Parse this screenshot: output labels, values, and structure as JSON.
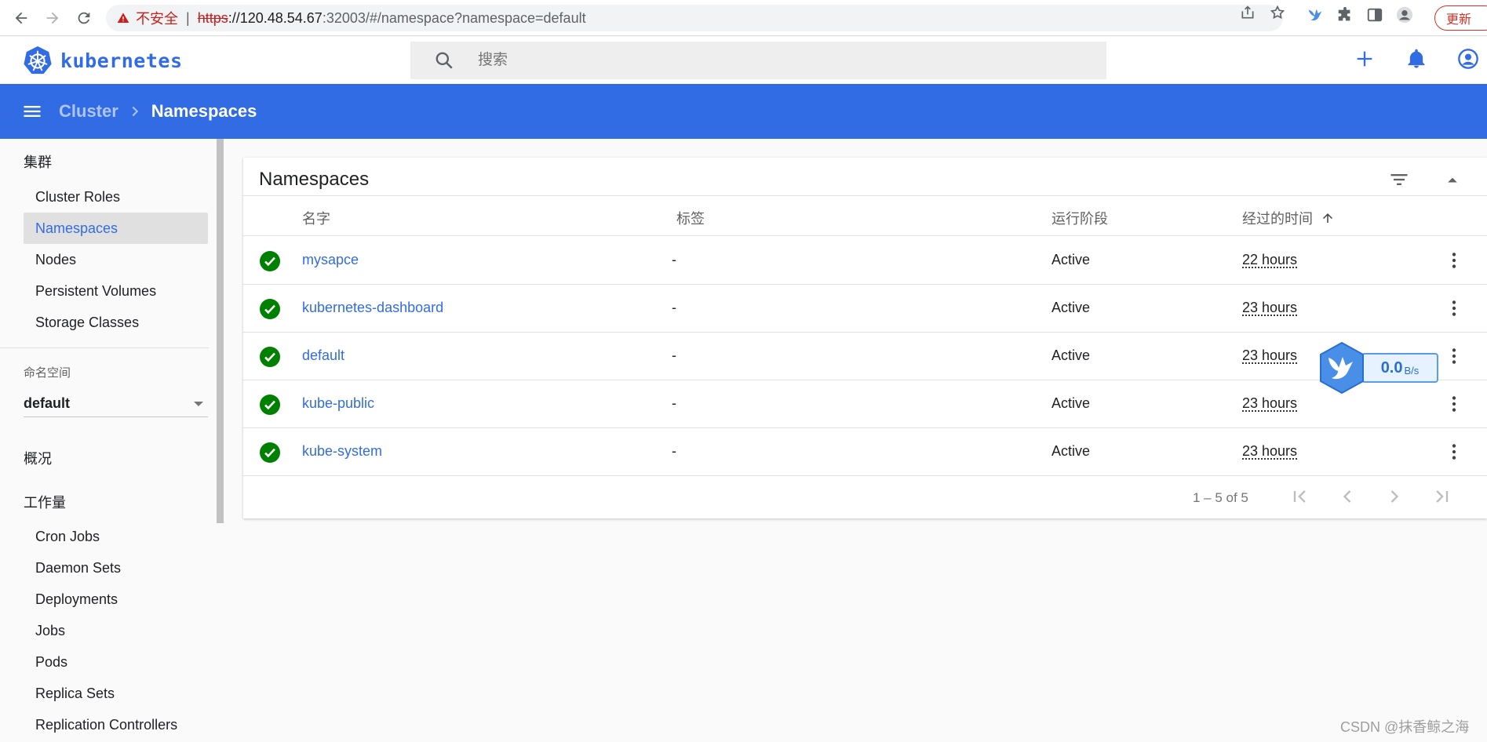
{
  "browser": {
    "security_label": "不安全",
    "separator": "|",
    "url_scheme": "https",
    "url_host": "://120.48.54.67",
    "url_path": ":32003/#/namespace?namespace=default",
    "update_label": "更新"
  },
  "header": {
    "logo_text": "kubernetes",
    "search_placeholder": "搜索"
  },
  "toolbar": {
    "breadcrumb_parent": "Cluster",
    "breadcrumb_current": "Namespaces"
  },
  "sidebar": {
    "cluster_section": "集群",
    "cluster_items": [
      "Cluster Roles",
      "Namespaces",
      "Nodes",
      "Persistent Volumes",
      "Storage Classes"
    ],
    "active_item": "Namespaces",
    "namespace_label": "命名空间",
    "namespace_value": "default",
    "overview_section": "概况",
    "workloads_section": "工作量",
    "workload_items": [
      "Cron Jobs",
      "Daemon Sets",
      "Deployments",
      "Jobs",
      "Pods",
      "Replica Sets",
      "Replication Controllers"
    ]
  },
  "card": {
    "title": "Namespaces",
    "columns": {
      "name": "名字",
      "labels": "标签",
      "phase": "运行阶段",
      "age": "经过的时间"
    },
    "rows": [
      {
        "name": "mysapce",
        "labels": "-",
        "phase": "Active",
        "age": "22 hours"
      },
      {
        "name": "kubernetes-dashboard",
        "labels": "-",
        "phase": "Active",
        "age": "23 hours"
      },
      {
        "name": "default",
        "labels": "-",
        "phase": "Active",
        "age": "23 hours"
      },
      {
        "name": "kube-public",
        "labels": "-",
        "phase": "Active",
        "age": "23 hours"
      },
      {
        "name": "kube-system",
        "labels": "-",
        "phase": "Active",
        "age": "23 hours"
      }
    ],
    "pagination": "1 – 5 of 5"
  },
  "speed_widget": {
    "value": "0.0",
    "unit": "B/s"
  },
  "watermark": "CSDN @抹香鲸之海",
  "colors": {
    "brand": "#326ce5",
    "success": "#008000",
    "warning": "#c5221f"
  },
  "icons": {
    "back": "arrow-left-icon",
    "forward": "arrow-right-icon",
    "reload": "reload-icon",
    "search": "search-icon",
    "add": "plus-icon",
    "notifications": "bell-icon",
    "account": "account-circle-icon",
    "menu": "menu-icon",
    "filter": "filter-icon",
    "collapse": "chevron-up-icon",
    "status": "check-circle-icon",
    "more": "more-vert-icon"
  }
}
